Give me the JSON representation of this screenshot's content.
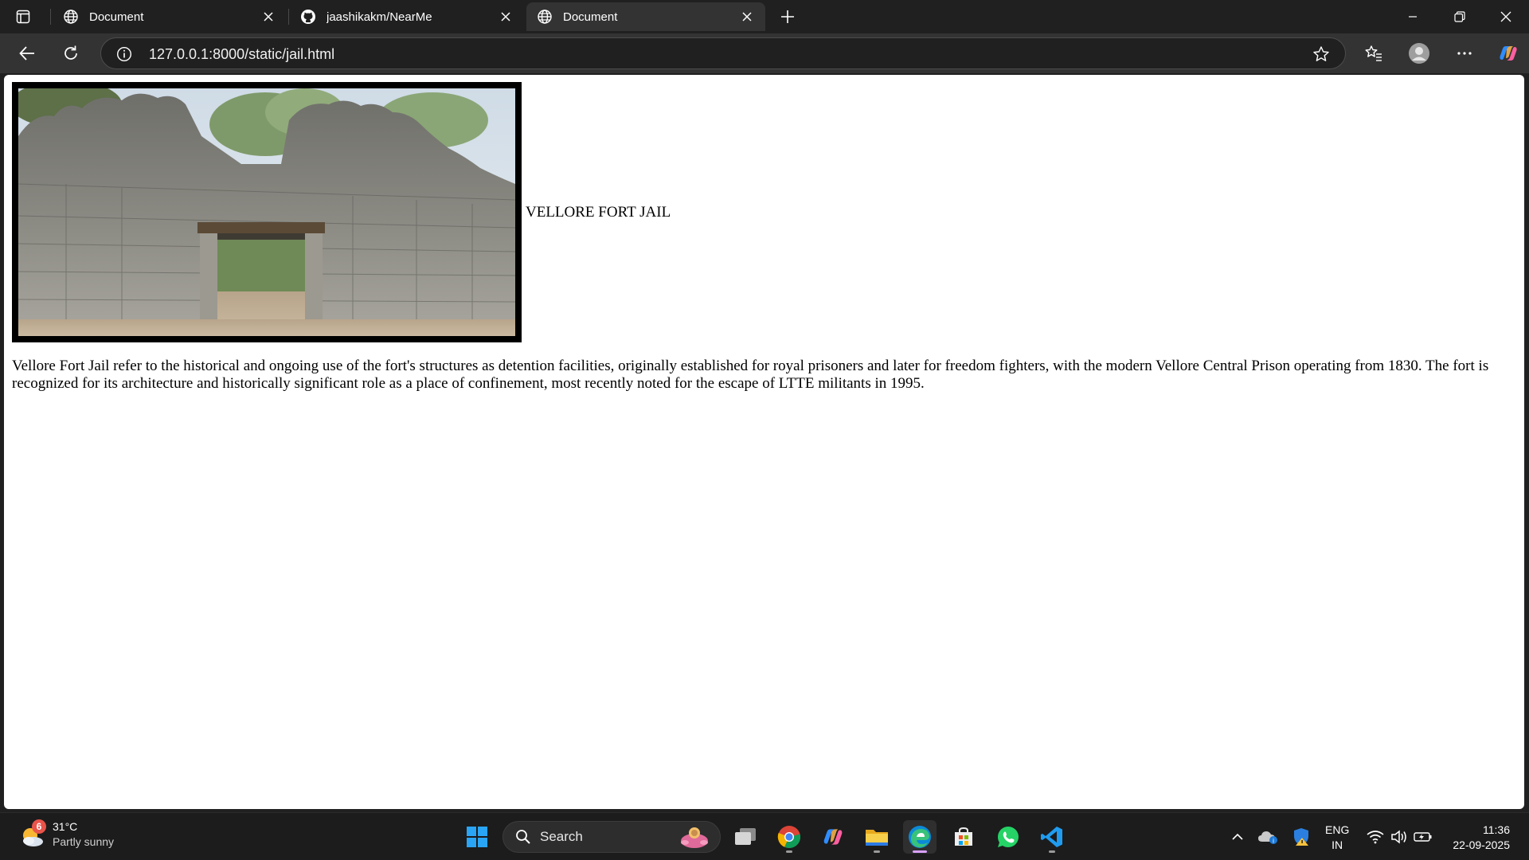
{
  "browser": {
    "tabs": [
      {
        "title": "Document",
        "active": false
      },
      {
        "title": "jaashikakm/NearMe",
        "active": false
      },
      {
        "title": "Document",
        "active": true
      }
    ],
    "address": "127.0.0.1:8000/static/jail.html"
  },
  "page": {
    "heading": "VELLORE FORT JAIL",
    "image_alt": "Vellore Fort Jail",
    "description": "Vellore Fort Jail refer to the historical and ongoing use of the fort's structures as detention facilities, originally established for royal prisoners and later for freedom fighters, with the modern Vellore Central Prison operating from 1830. The fort is recognized for its architecture and historically significant role as a place of confinement, most recently noted for the escape of LTTE militants in 1995."
  },
  "taskbar": {
    "weather": {
      "badge": "6",
      "temp": "31°C",
      "condition": "Partly sunny"
    },
    "search_label": "Search",
    "apps": [
      "start-icon",
      "task-view-icon",
      "chrome-icon",
      "copilot-icon",
      "file-explorer-icon",
      "edge-icon",
      "store-icon",
      "whatsapp-icon",
      "vscode-icon"
    ],
    "lang_top": "ENG",
    "lang_bottom": "IN",
    "time": "11:36",
    "date": "22-09-2025"
  }
}
